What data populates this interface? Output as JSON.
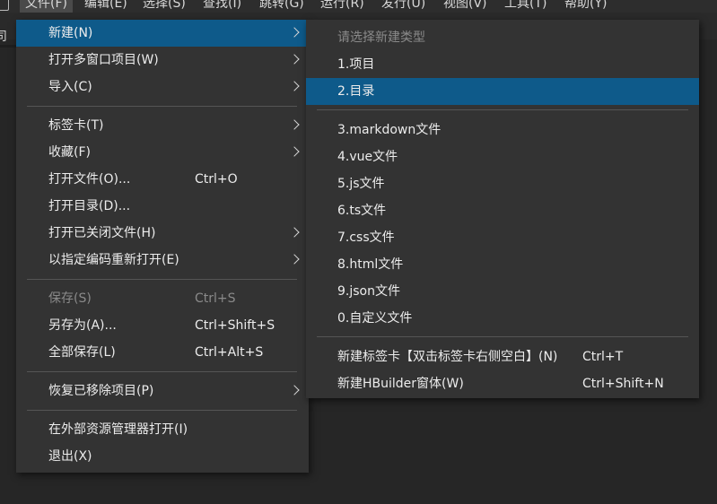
{
  "menubar": {
    "items": [
      "文件(F)",
      "编辑(E)",
      "选择(S)",
      "查找(I)",
      "跳转(G)",
      "运行(R)",
      "发行(U)",
      "视图(V)",
      "工具(T)",
      "帮助(Y)"
    ]
  },
  "tabstrip": {
    "fragment": "司"
  },
  "file_menu": {
    "new": {
      "label": "新建(N)"
    },
    "open_multi_window": {
      "label": "打开多窗口项目(W)"
    },
    "import": {
      "label": "导入(C)"
    },
    "tabs": {
      "label": "标签卡(T)"
    },
    "favorites": {
      "label": "收藏(F)"
    },
    "open_file": {
      "label": "打开文件(O)...",
      "shortcut": "Ctrl+O"
    },
    "open_dir": {
      "label": "打开目录(D)..."
    },
    "open_closed": {
      "label": "打开已关闭文件(H)"
    },
    "reopen_encoding": {
      "label": "以指定编码重新打开(E)"
    },
    "save": {
      "label": "保存(S)",
      "shortcut": "Ctrl+S"
    },
    "save_as": {
      "label": "另存为(A)...",
      "shortcut": "Ctrl+Shift+S"
    },
    "save_all": {
      "label": "全部保存(L)",
      "shortcut": "Ctrl+Alt+S"
    },
    "restore_removed": {
      "label": "恢复已移除项目(P)"
    },
    "open_explorer": {
      "label": "在外部资源管理器打开(I)"
    },
    "exit": {
      "label": "退出(X)"
    }
  },
  "new_submenu": {
    "header": "请选择新建类型",
    "items": [
      {
        "label": "1.项目"
      },
      {
        "label": "2.目录"
      },
      {
        "label": "3.markdown文件"
      },
      {
        "label": "4.vue文件"
      },
      {
        "label": "5.js文件"
      },
      {
        "label": "6.ts文件"
      },
      {
        "label": "7.css文件"
      },
      {
        "label": "8.html文件"
      },
      {
        "label": "9.json文件"
      },
      {
        "label": "0.自定义文件"
      }
    ],
    "new_tab": {
      "label": "新建标签卡【双击标签卡右侧空白】(N)",
      "shortcut": "Ctrl+T"
    },
    "new_window": {
      "label": "新建HBuilder窗体(W)",
      "shortcut": "Ctrl+Shift+N"
    }
  }
}
